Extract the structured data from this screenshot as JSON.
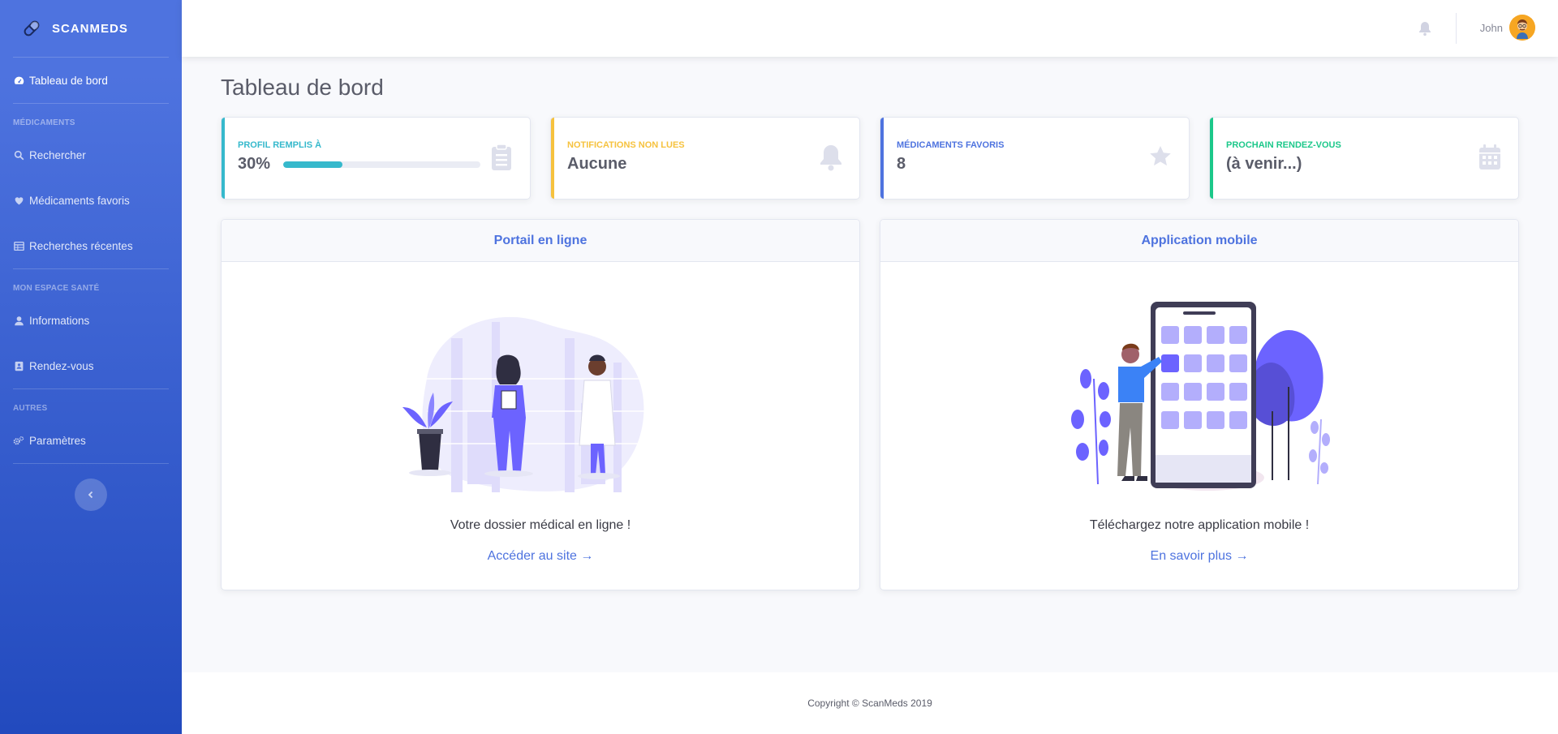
{
  "brand": {
    "name": "SCANMEDS",
    "logo_icon": "pill-icon"
  },
  "sidebar": {
    "dashboard": {
      "label": "Tableau de bord",
      "icon": "tachometer-icon"
    },
    "headings": {
      "medicaments": "MÉDICAMENTS",
      "espace": "MON ESPACE SANTÉ",
      "autres": "AUTRES"
    },
    "items": {
      "search": {
        "label": "Rechercher",
        "icon": "search-icon"
      },
      "favorites": {
        "label": "Médicaments favoris",
        "icon": "heart-icon"
      },
      "recent": {
        "label": "Recherches récentes",
        "icon": "table-icon"
      },
      "info": {
        "label": "Informations",
        "icon": "user-icon"
      },
      "appointments": {
        "label": "Rendez-vous",
        "icon": "address-card-icon"
      },
      "settings": {
        "label": "Paramètres",
        "icon": "cogs-icon"
      }
    },
    "toggle_icon": "chevron-left-icon"
  },
  "topbar": {
    "user_name": "John",
    "bell_icon": "bell-icon"
  },
  "page": {
    "title": "Tableau de bord"
  },
  "cards": [
    {
      "label": "PROFIL REMPLIS À",
      "value": "30%",
      "progress": 0.3,
      "accent": "#36b9cc",
      "icon": "clipboard-icon"
    },
    {
      "label": "NOTIFICATIONS NON LUES",
      "value": "Aucune",
      "accent": "#f6c23e",
      "icon": "bell-icon"
    },
    {
      "label": "MÉDICAMENTS FAVORIS",
      "value": "8",
      "accent": "#4e73df",
      "icon": "star-icon"
    },
    {
      "label": "PROCHAIN RENDEZ-VOUS",
      "value": "(à venir...)",
      "accent": "#1cc88a",
      "icon": "calendar-icon"
    }
  ],
  "panels": {
    "portal": {
      "title": "Portail en ligne",
      "text": "Votre dossier médical en ligne !",
      "link": "Accéder au site →"
    },
    "mobile": {
      "title": "Application mobile",
      "text": "Téléchargez notre application mobile !",
      "link": "En savoir plus →"
    }
  },
  "footer": {
    "copyright": "Copyright © ScanMeds 2019"
  },
  "colors": {
    "primary": "#4e73df",
    "info": "#36b9cc",
    "warning": "#f6c23e",
    "success": "#1cc88a"
  }
}
